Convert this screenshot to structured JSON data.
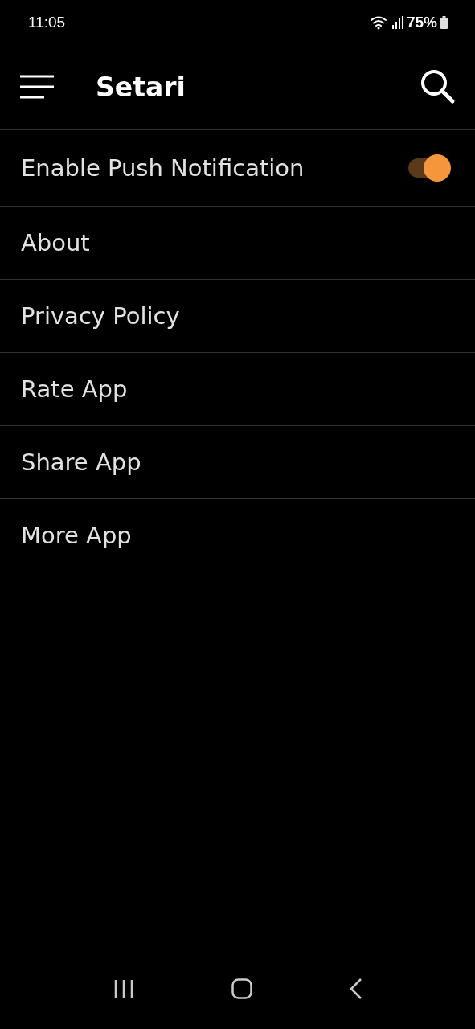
{
  "status_bar": {
    "time": "11:05",
    "battery": "75%"
  },
  "app_bar": {
    "title": "Setari"
  },
  "items": [
    {
      "kind": "toggle",
      "label": "Enable Push Notification",
      "on": true
    },
    {
      "kind": "link",
      "label": "About"
    },
    {
      "kind": "link",
      "label": "Privacy Policy"
    },
    {
      "kind": "link",
      "label": "Rate App"
    },
    {
      "kind": "link",
      "label": "Share App"
    },
    {
      "kind": "link",
      "label": "More App"
    }
  ]
}
